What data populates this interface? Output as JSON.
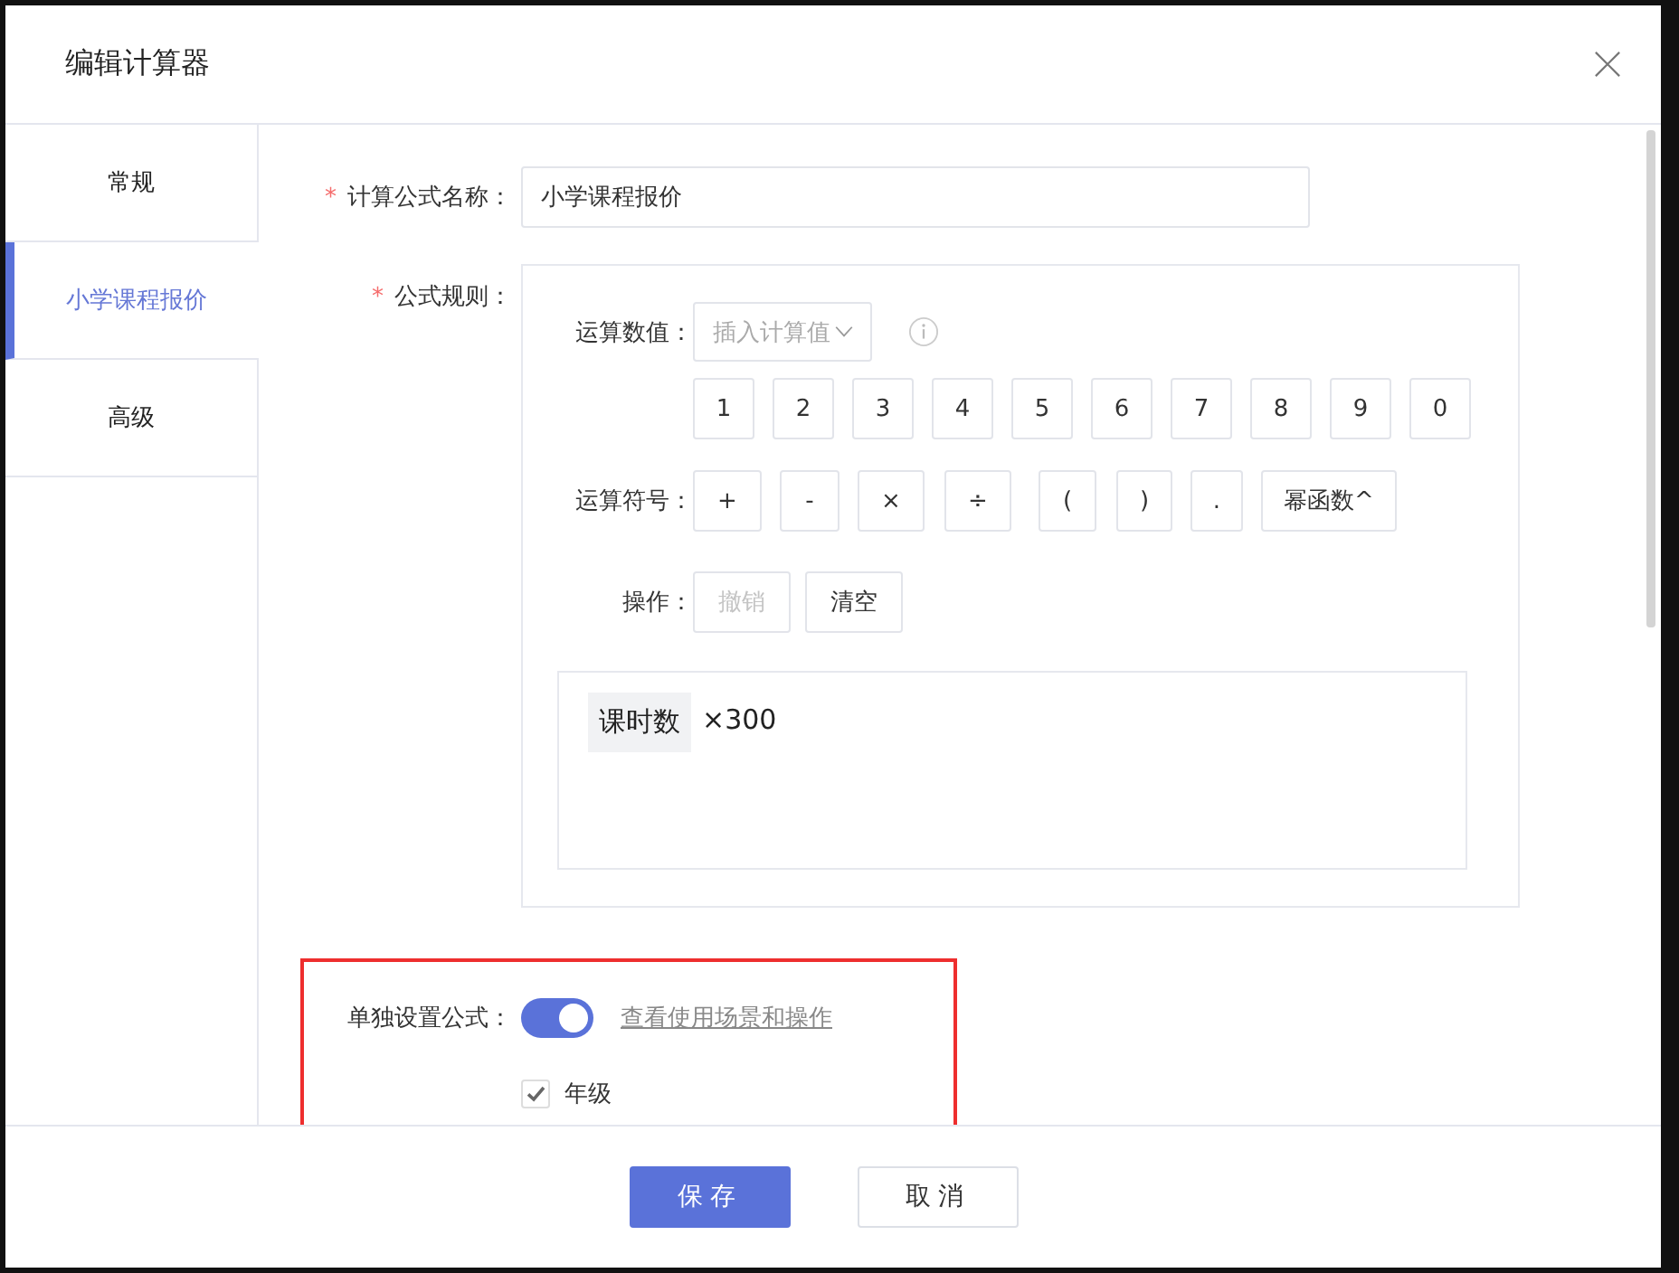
{
  "dialog": {
    "title": "编辑计算器"
  },
  "sidebar": {
    "tabs": [
      {
        "label": "常规",
        "selected": false
      },
      {
        "label": "小学课程报价",
        "selected": true
      },
      {
        "label": "高级",
        "selected": false
      }
    ]
  },
  "form": {
    "name_field": {
      "required_mark": "*",
      "label": "计算公式名称：",
      "value": "小学课程报价"
    },
    "rule": {
      "required_mark": "*",
      "label": "公式规则：",
      "value_row": {
        "label": "运算数值：",
        "placeholder": "插入计算值"
      },
      "digits": [
        "1",
        "2",
        "3",
        "4",
        "5",
        "6",
        "7",
        "8",
        "9",
        "0"
      ],
      "operator_row": {
        "label": "运算符号：",
        "keys": [
          "+",
          "-",
          "×",
          "÷",
          "(",
          ")",
          ".",
          "幂函数^"
        ]
      },
      "action_row": {
        "label": "操作：",
        "buttons": [
          {
            "label": "撤销",
            "disabled": true
          },
          {
            "label": "清空",
            "disabled": false
          }
        ]
      },
      "formula": [
        {
          "kind": "variable",
          "text": "课时数"
        },
        {
          "kind": "text",
          "text": "×300"
        }
      ]
    },
    "separate_formula": {
      "label": "单独设置公式：",
      "on": true,
      "link": "查看使用场景和操作",
      "options": [
        {
          "label": "年级",
          "checked": true
        }
      ]
    }
  },
  "footer": {
    "buttons": [
      {
        "label": "保存",
        "kind": "primary"
      },
      {
        "label": "取消",
        "kind": "default"
      }
    ]
  }
}
